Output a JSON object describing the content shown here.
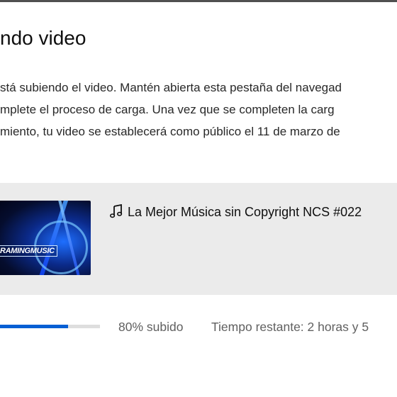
{
  "dialog": {
    "title": "ndo video",
    "message_lines": [
      "stá subiendo el video. Mantén abierta esta pestaña del navegad",
      "mplete el proceso de carga. Una vez que se completen la carg",
      "miento, tu video se establecerá como público el 11 de marzo de"
    ]
  },
  "video": {
    "title": "La Mejor Música sin Copyright NCS #022",
    "title_icon": "music-note-icon",
    "thumbnail_text": "RAMINGMUSIC"
  },
  "upload": {
    "progress_percent": 80,
    "status_text": "80% subido",
    "remaining_text": "Tiempo restante: 2 horas y 5"
  },
  "colors": {
    "progress": "#065fd4",
    "card_background": "#ebebeb"
  }
}
